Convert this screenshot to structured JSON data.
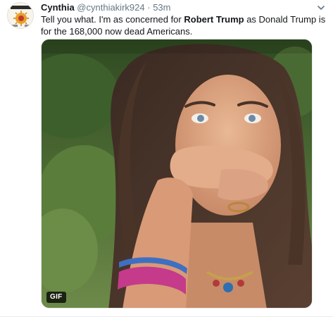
{
  "tweet": {
    "display_name": "Cynthia",
    "handle": "@cynthiakirk924",
    "separator": "·",
    "time": "53m",
    "text_before": "Tell you what. I'm as concerned for ",
    "text_bold": "Robert Trump",
    "text_after": " as Donald Trump is for the 168,000 now dead Americans.",
    "media": {
      "badge": "GIF",
      "description_icon": "gif-video"
    }
  },
  "icons": {
    "avatar": "profile-avatar-icon",
    "caret": "chevron-down-icon"
  },
  "colors": {
    "text": "#14171a",
    "secondary": "#657786",
    "border": "#e6ecf0"
  }
}
